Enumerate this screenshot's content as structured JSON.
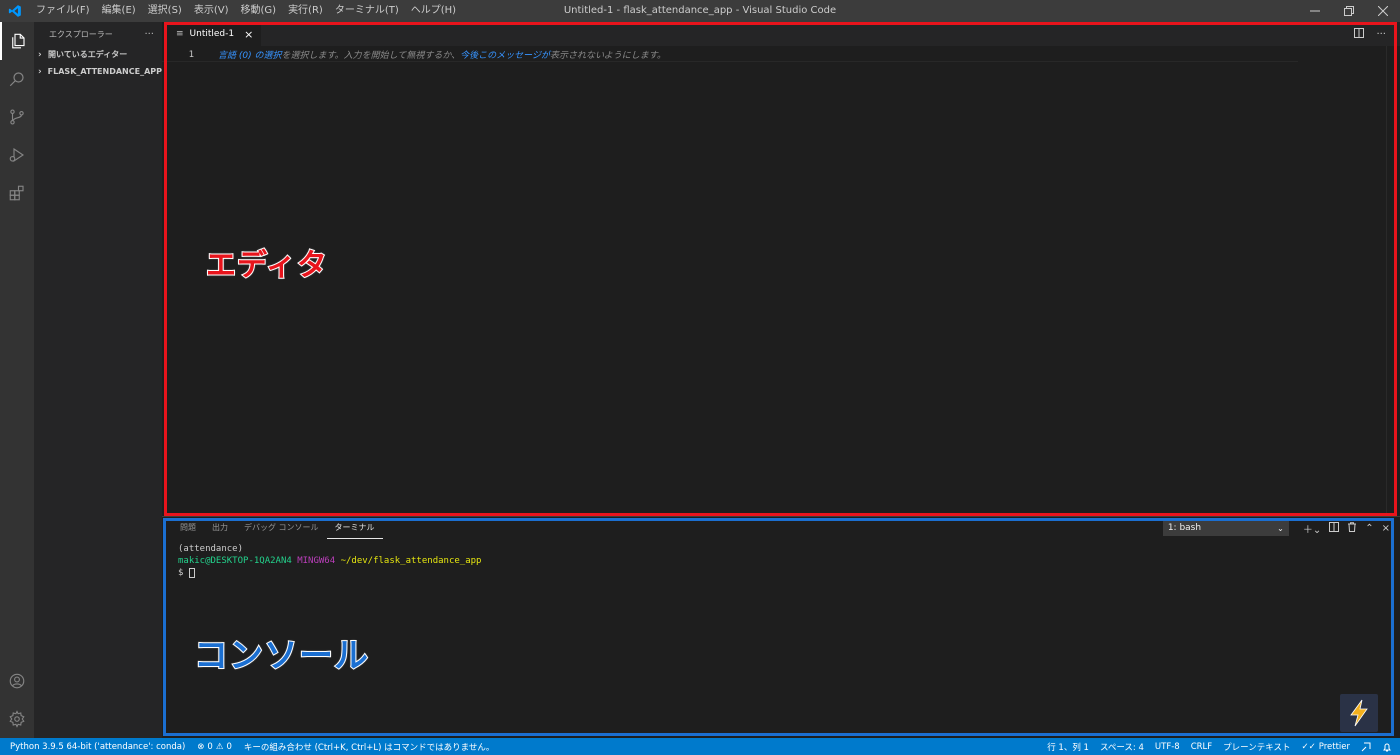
{
  "window": {
    "title": "Untitled-1 - flask_attendance_app - Visual Studio Code",
    "menu": [
      "ファイル(F)",
      "編集(E)",
      "選択(S)",
      "表示(V)",
      "移動(G)",
      "実行(R)",
      "ターミナル(T)",
      "ヘルプ(H)"
    ]
  },
  "sidebar": {
    "title": "エクスプローラー",
    "more": "···",
    "sections": [
      "開いているエディター",
      "FLASK_ATTENDANCE_APP"
    ]
  },
  "editor": {
    "tab_label": "Untitled-1",
    "line_number": "1",
    "hint_part1": "言語 (0) の選択",
    "hint_part2": "を選択します。入力を開始して無視するか、",
    "hint_part3": "今後このメッセージが",
    "hint_part4": "表示されないようにします。"
  },
  "panel": {
    "tabs": [
      "問題",
      "出力",
      "デバッグ コンソール",
      "ターミナル"
    ],
    "terminal_select": "1: bash",
    "lines": {
      "env": "(attendance)",
      "user": "makic@DESKTOP-1QA2AN4",
      "shell": "MINGW64",
      "path": "~/dev/flask_attendance_app",
      "prompt": "$"
    }
  },
  "annotations": {
    "editor_label": "エディタ",
    "console_label": "コンソール",
    "editor_color": "#e8141c",
    "console_color": "#1b6fd1"
  },
  "statusbar": {
    "python": "Python 3.9.5 64-bit ('attendance': conda)",
    "errors": "0",
    "warnings": "0",
    "message": "キーの組み合わせ (Ctrl+K, Ctrl+L) はコマンドではありません。",
    "position": "行 1、列 1",
    "spaces": "スペース: 4",
    "encoding": "UTF-8",
    "eol": "CRLF",
    "language": "プレーンテキスト",
    "formatter": "Prettier"
  },
  "colors": {
    "statusbar": "#007acc",
    "activitybar": "#333333",
    "sidebar": "#252526",
    "editor": "#1e1e1e"
  }
}
